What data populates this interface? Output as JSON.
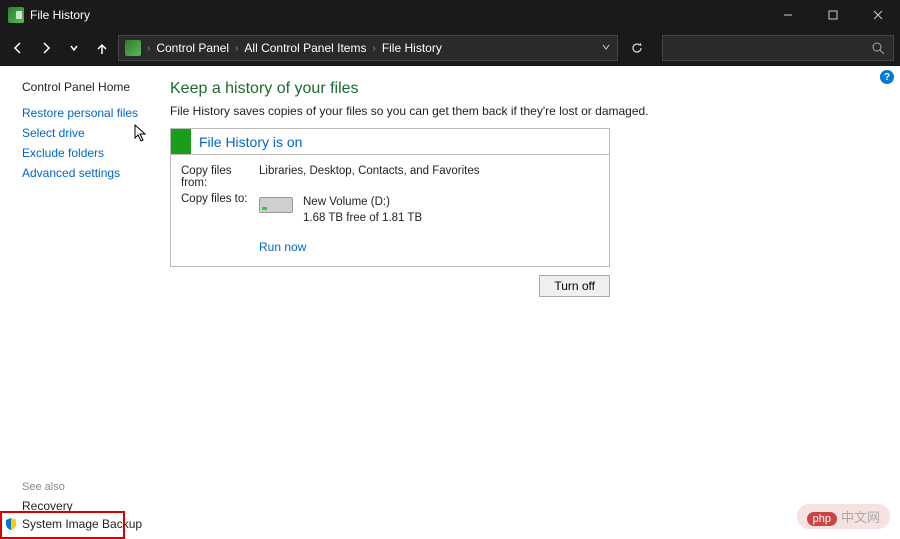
{
  "window": {
    "title": "File History"
  },
  "breadcrumb": {
    "items": [
      "Control Panel",
      "All Control Panel Items",
      "File History"
    ]
  },
  "sidebar": {
    "home": "Control Panel Home",
    "links": {
      "restore": "Restore personal files",
      "select_drive": "Select drive",
      "exclude": "Exclude folders",
      "advanced": "Advanced settings"
    },
    "see_also_label": "See also",
    "see_also": {
      "recovery": "Recovery",
      "system_image": "System Image Backup"
    }
  },
  "main": {
    "heading": "Keep a history of your files",
    "description": "File History saves copies of your files so you can get them back if they're lost or damaged.",
    "status_text": "File History is on",
    "copy_from_label": "Copy files from:",
    "copy_from_value": "Libraries, Desktop, Contacts, and Favorites",
    "copy_to_label": "Copy files to:",
    "drive_name": "New Volume (D:)",
    "drive_space": "1.68 TB free of 1.81 TB",
    "run_now": "Run now",
    "turn_off": "Turn off"
  },
  "watermark": {
    "badge": "php",
    "text": "中文网"
  }
}
